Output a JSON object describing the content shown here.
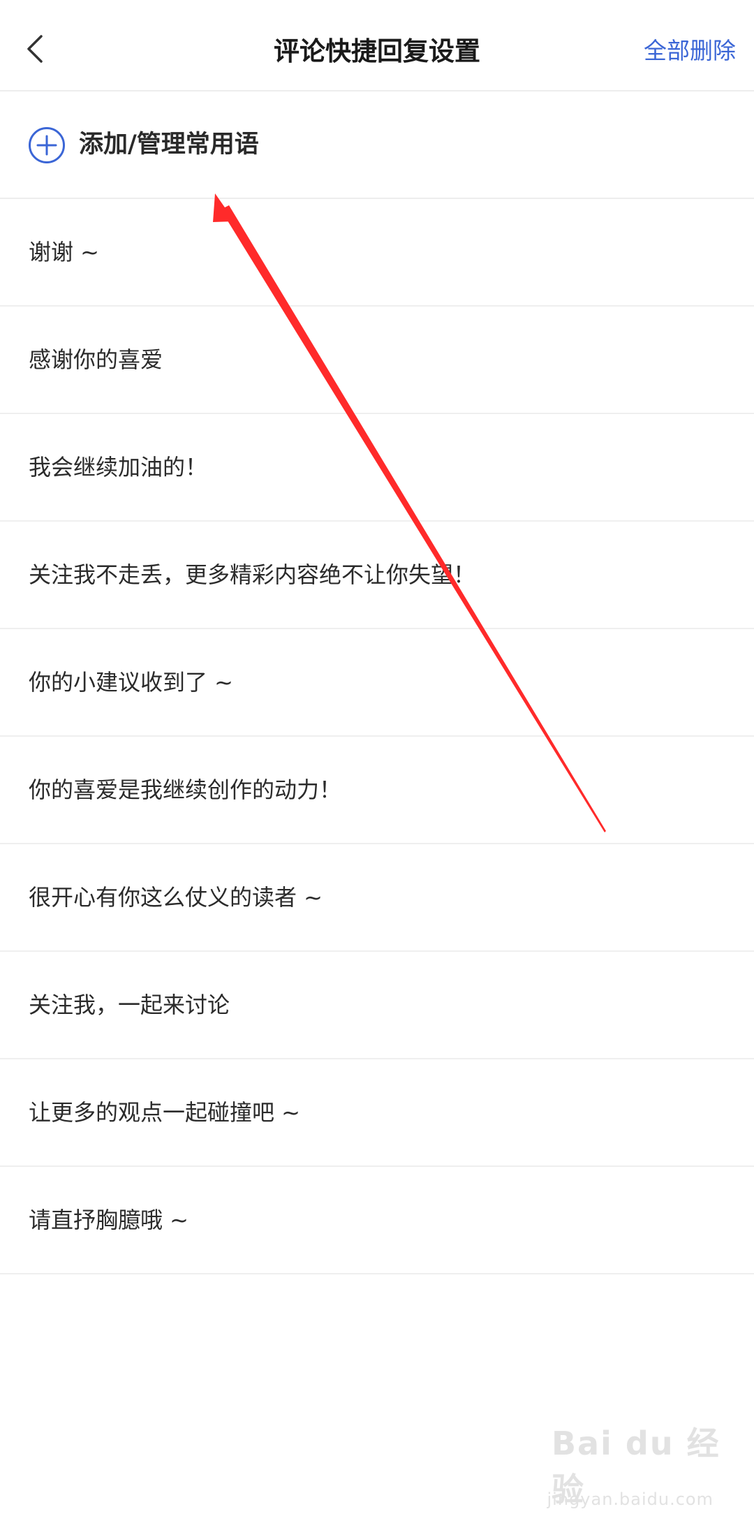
{
  "header": {
    "title": "评论快捷回复设置",
    "right_action": "全部删除"
  },
  "add_row": {
    "label": "添加/管理常用语"
  },
  "phrases": [
    "谢谢 ~",
    "感谢你的喜爱",
    "我会继续加油的！",
    "关注我不走丢，更多精彩内容绝不让你失望！",
    "你的小建议收到了 ~",
    "你的喜爱是我继续创作的动力！",
    "很开心有你这么仗义的读者 ~",
    "关注我，一起来讨论",
    "让更多的观点一起碰撞吧 ~",
    "请直抒胸臆哦 ~"
  ],
  "watermark": {
    "text": "Bai du 经验",
    "subtext": "jingyan.baidu.com"
  },
  "colors": {
    "accent": "#3b66d6",
    "annotation_arrow": "#ff2a2a"
  },
  "icons": {
    "back": "chevron-left-icon",
    "add": "plus-circle-icon"
  }
}
